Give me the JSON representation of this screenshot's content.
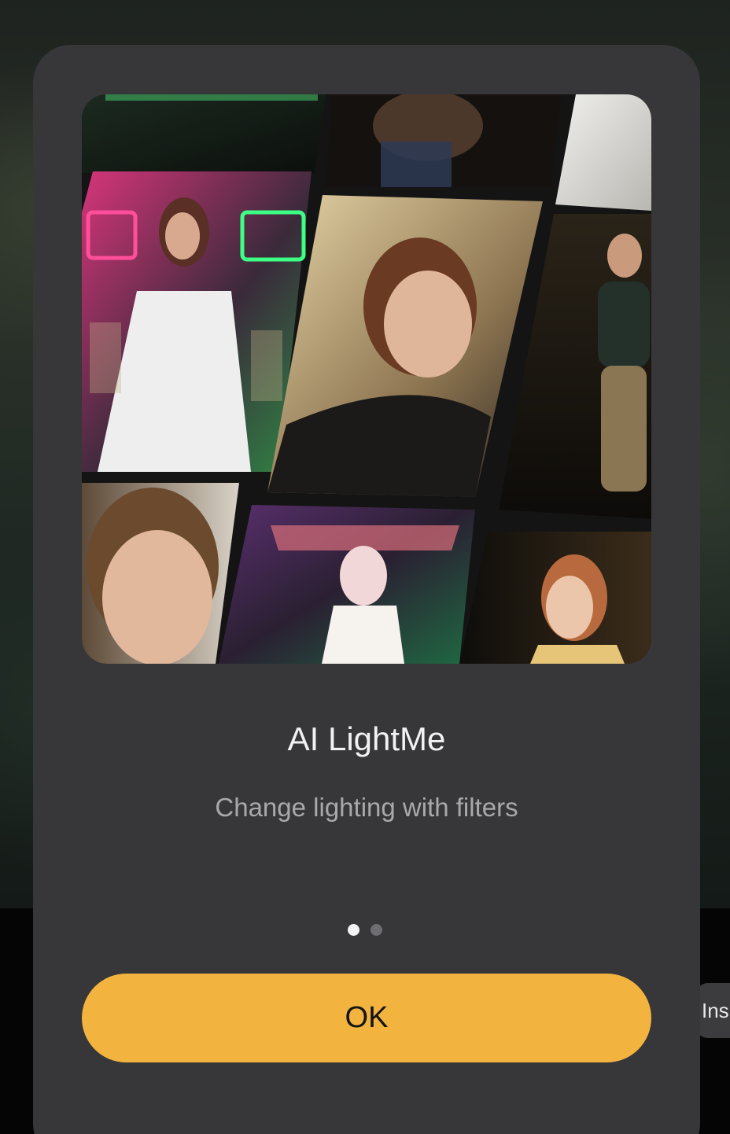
{
  "dialog": {
    "title": "AI LightMe",
    "subtitle": "Change lighting with filters",
    "ok_label": "OK",
    "pager": {
      "total": 2,
      "active_index": 0
    },
    "accent_color": "#f3b43f",
    "surface_color": "#373639"
  },
  "background": {
    "partial_pill_label": "Ins"
  }
}
